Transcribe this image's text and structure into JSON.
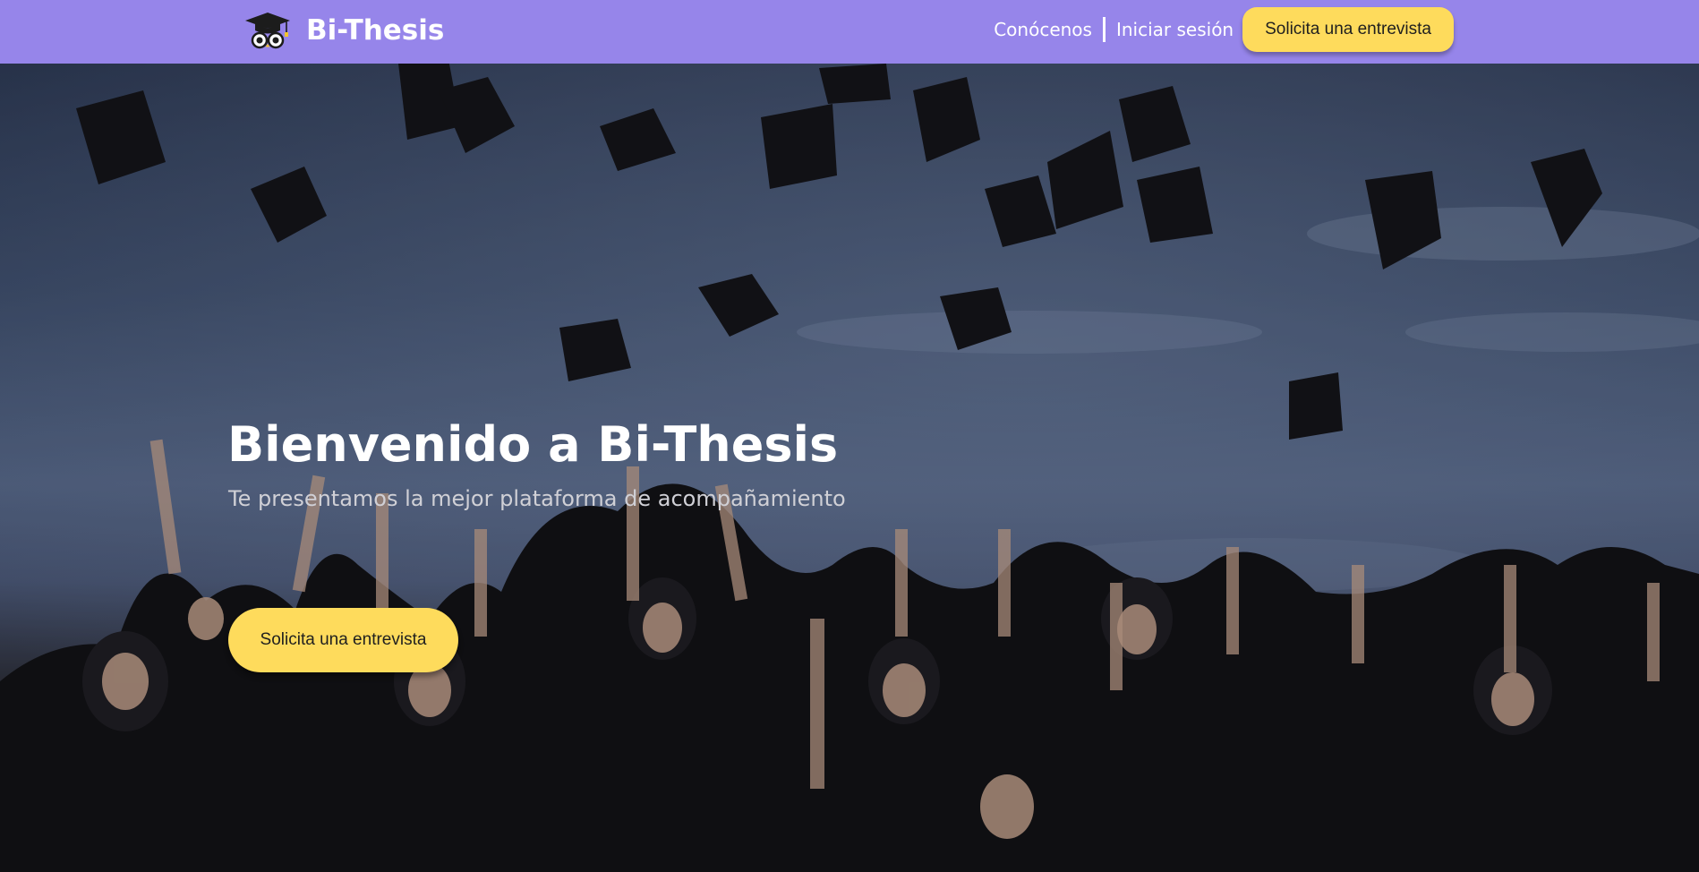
{
  "colors": {
    "navbar_bg": "#9685ea",
    "cta_bg": "#fedb5c",
    "text_light": "#ffffff"
  },
  "header": {
    "logo_icon": "graduation-cap-owl-icon",
    "brand_name": "Bi-Thesis",
    "nav": {
      "about_label": "Conócenos",
      "login_label": "Iniciar sesión",
      "cta_label": "Solicita una entrevista"
    }
  },
  "hero": {
    "background": "graduates-throwing-caps-photo",
    "title": "Bienvenido a Bi-Thesis",
    "subtitle": "Te presentamos la mejor plataforma de acompañamiento",
    "cta_label": "Solicita una entrevista"
  }
}
